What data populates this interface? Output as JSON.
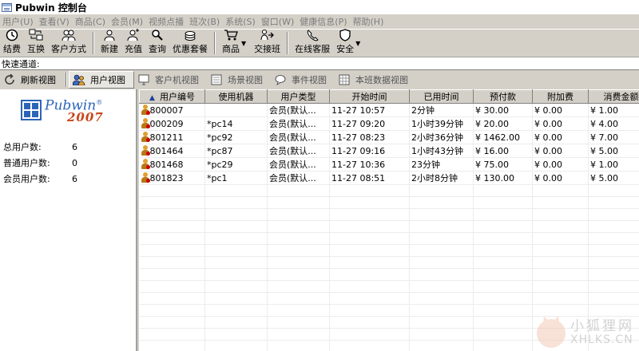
{
  "window": {
    "title": "Pubwin 控制台"
  },
  "menu": [
    "用户(U)",
    "查看(V)",
    "商品(C)",
    "会员(M)",
    "视频点播",
    "班次(B)",
    "系统(S)",
    "窗口(W)",
    "健康信息(P)",
    "帮助(H)"
  ],
  "toolbar": {
    "checkout": "结费",
    "swap": "互换",
    "client_mode": "客户方式",
    "new": "新建",
    "recharge": "充值",
    "query": "查询",
    "discount_meal": "优惠套餐",
    "goods": "商品",
    "handover": "交接班",
    "online_service": "在线客服",
    "security": "安全"
  },
  "quickbar": {
    "label": "快速通道:",
    "value": ""
  },
  "views": {
    "refresh": "刷新视图",
    "user": "用户视图",
    "client": "客户机视图",
    "scene": "场景视图",
    "event": "事件视图",
    "shift": "本班数据视图"
  },
  "logo": {
    "name": "Pubwin",
    "year": "2007",
    "reg": "®"
  },
  "stats": [
    {
      "label": "总用户数:",
      "value": "6"
    },
    {
      "label": "普通用户数:",
      "value": "0"
    },
    {
      "label": "会员用户数:",
      "value": "6"
    }
  ],
  "table": {
    "columns": [
      "用户编号",
      "使用机器",
      "用户类型",
      "开始时间",
      "已用时间",
      "预付款",
      "附加费",
      "消费金额",
      ""
    ],
    "rows": [
      {
        "id": "800007",
        "machine": "",
        "type": "会员(默认...",
        "start": "11-27 10:57",
        "used": "2分钟",
        "prepaid": "¥ 30.00",
        "extra": "¥ 0.00",
        "spent": "¥ 1.00",
        "status": "绿"
      },
      {
        "id": "000209",
        "machine": "*pc14",
        "type": "会员(默认...",
        "start": "11-27 09:20",
        "used": "1小时39分钟",
        "prepaid": "¥ 20.00",
        "extra": "¥ 0.00",
        "spent": "¥ 4.00",
        "status": "绿"
      },
      {
        "id": "801211",
        "machine": "*pc92",
        "type": "会员(默认...",
        "start": "11-27 08:23",
        "used": "2小时36分钟",
        "prepaid": "¥ 1462.00",
        "extra": "¥ 0.00",
        "spent": "¥ 7.00",
        "status": "绿"
      },
      {
        "id": "801464",
        "machine": "*pc87",
        "type": "会员(默认...",
        "start": "11-27 09:16",
        "used": "1小时43分钟",
        "prepaid": "¥ 16.00",
        "extra": "¥ 0.00",
        "spent": "¥ 5.00",
        "status": "绿"
      },
      {
        "id": "801468",
        "machine": "*pc29",
        "type": "会员(默认...",
        "start": "11-27 10:36",
        "used": "23分钟",
        "prepaid": "¥ 75.00",
        "extra": "¥ 0.00",
        "spent": "¥ 1.00",
        "status": "绿"
      },
      {
        "id": "801823",
        "machine": "*pc1",
        "type": "会员(默认...",
        "start": "11-27 08:51",
        "used": "2小时8分钟",
        "prepaid": "¥ 130.00",
        "extra": "¥ 0.00",
        "spent": "¥ 5.00",
        "status": "绿"
      }
    ]
  },
  "watermark": {
    "cn": "小狐狸网",
    "en": "XHLKS.CN"
  },
  "colors": {
    "accent": "#2c64b8",
    "year": "#c8461c",
    "chrome": "#d4d0c8"
  }
}
